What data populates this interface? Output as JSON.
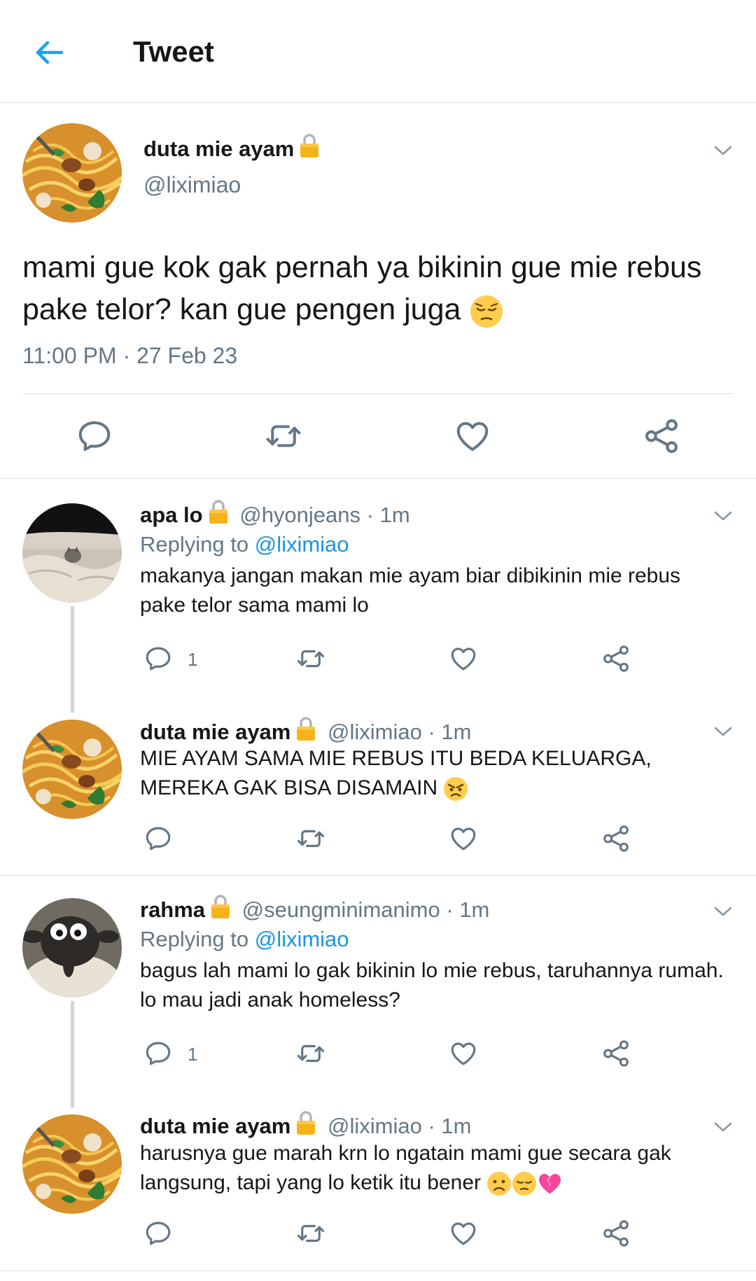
{
  "header": {
    "title": "Tweet"
  },
  "main_tweet": {
    "name": "duta mie ayam",
    "handle": "@liximiao",
    "text": "mami gue kok gak pernah ya bikinin gue mie rebus pake telor? kan gue pengen juga",
    "text_emoji": "pensive-face",
    "time": "11:00 PM",
    "date": "27 Feb 23"
  },
  "replies": [
    {
      "name": "apa lo",
      "handle": "@hyonjeans",
      "time": "1m",
      "replying_prefix": "Replying to",
      "replying_handle": "@liximiao",
      "text": "makanya jangan makan mie ayam biar dibikinin mie rebus pake telor sama mami lo",
      "reply_count": "1"
    },
    {
      "name": "duta mie ayam",
      "handle": "@liximiao",
      "time": "1m",
      "text": "MIE AYAM SAMA MIE REBUS ITU BEDA KELUARGA, MEREKA GAK BISA DISAMAIN",
      "text_emoji": "angry-face"
    },
    {
      "name": "rahma",
      "handle": "@seungminimanimo",
      "time": "1m",
      "replying_prefix": "Replying to",
      "replying_handle": "@liximiao",
      "text": "bagus lah mami lo gak bikinin lo mie rebus, taruhannya rumah. lo mau jadi anak homeless?",
      "reply_count": "1"
    },
    {
      "name": "duta mie ayam",
      "handle": "@liximiao",
      "time": "1m",
      "text": "harusnya gue marah krn lo ngatain mami gue secara gak langsung, tapi yang lo ketik itu bener",
      "text_emoji": "frowning-pensive-broken-heart"
    }
  ],
  "separator": " · ",
  "colors": {
    "accent": "#1b95e0",
    "gray": "#657786",
    "divider": "#dadfe3",
    "lock": "#f4b400"
  }
}
